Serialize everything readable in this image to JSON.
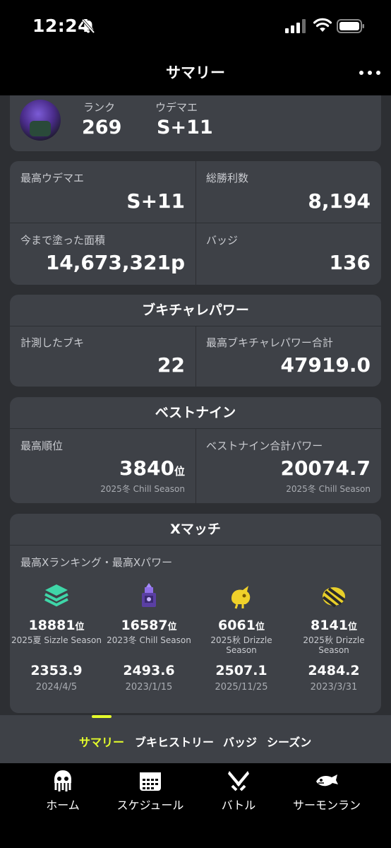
{
  "status_bar": {
    "time": "12:24"
  },
  "header": {
    "title": "サマリー"
  },
  "profile": {
    "rank_label": "ランク",
    "rank_value": "269",
    "udemae_label": "ウデマエ",
    "udemae_value": "S+11"
  },
  "stats": {
    "max_udemae_label": "最高ウデマエ",
    "max_udemae_value": "S+11",
    "wins_label": "総勝利数",
    "wins_value": "8,194",
    "painted_label": "今まで塗った面積",
    "painted_value": "14,673,321p",
    "badges_label": "バッジ",
    "badges_value": "136"
  },
  "weapon_power": {
    "title": "ブキチャレパワー",
    "measured_label": "計測したブキ",
    "measured_value": "22",
    "max_total_label": "最高ブキチャレパワー合計",
    "max_total_value": "47919.0"
  },
  "best_nine": {
    "title": "ベストナイン",
    "max_rank_label": "最高順位",
    "max_rank_value": "3840",
    "max_rank_unit": "位",
    "max_rank_season": "2025冬 Chill Season",
    "total_power_label": "ベストナイン合計パワー",
    "total_power_value": "20074.7",
    "total_power_season": "2025冬 Chill Season"
  },
  "x_match": {
    "title": "Xマッチ",
    "subtitle": "最高Xランキング・最高Xパワー",
    "entries": [
      {
        "icon": "splat-zones-icon",
        "rank": "18881",
        "unit": "位",
        "season": "2025夏 Sizzle Season",
        "power": "2353.9",
        "date": "2024/4/5"
      },
      {
        "icon": "tower-control-icon",
        "rank": "16587",
        "unit": "位",
        "season": "2023冬 Chill Season",
        "power": "2493.6",
        "date": "2023/1/15"
      },
      {
        "icon": "rainmaker-icon",
        "rank": "6061",
        "unit": "位",
        "season": "2025秋 Drizzle Season",
        "power": "2507.1",
        "date": "2025/11/25"
      },
      {
        "icon": "clam-blitz-icon",
        "rank": "8141",
        "unit": "位",
        "season": "2025秋 Drizzle Season",
        "power": "2484.2",
        "date": "2023/3/31"
      }
    ]
  },
  "tabs": [
    "サマリー",
    "ブキヒストリー",
    "バッジ",
    "シーズン"
  ],
  "nav": [
    "ホーム",
    "スケジュール",
    "バトル",
    "サーモンラン"
  ],
  "colors": {
    "accent": "#e6ff2b",
    "card": "#3e4147",
    "background": "#2d2f33"
  }
}
